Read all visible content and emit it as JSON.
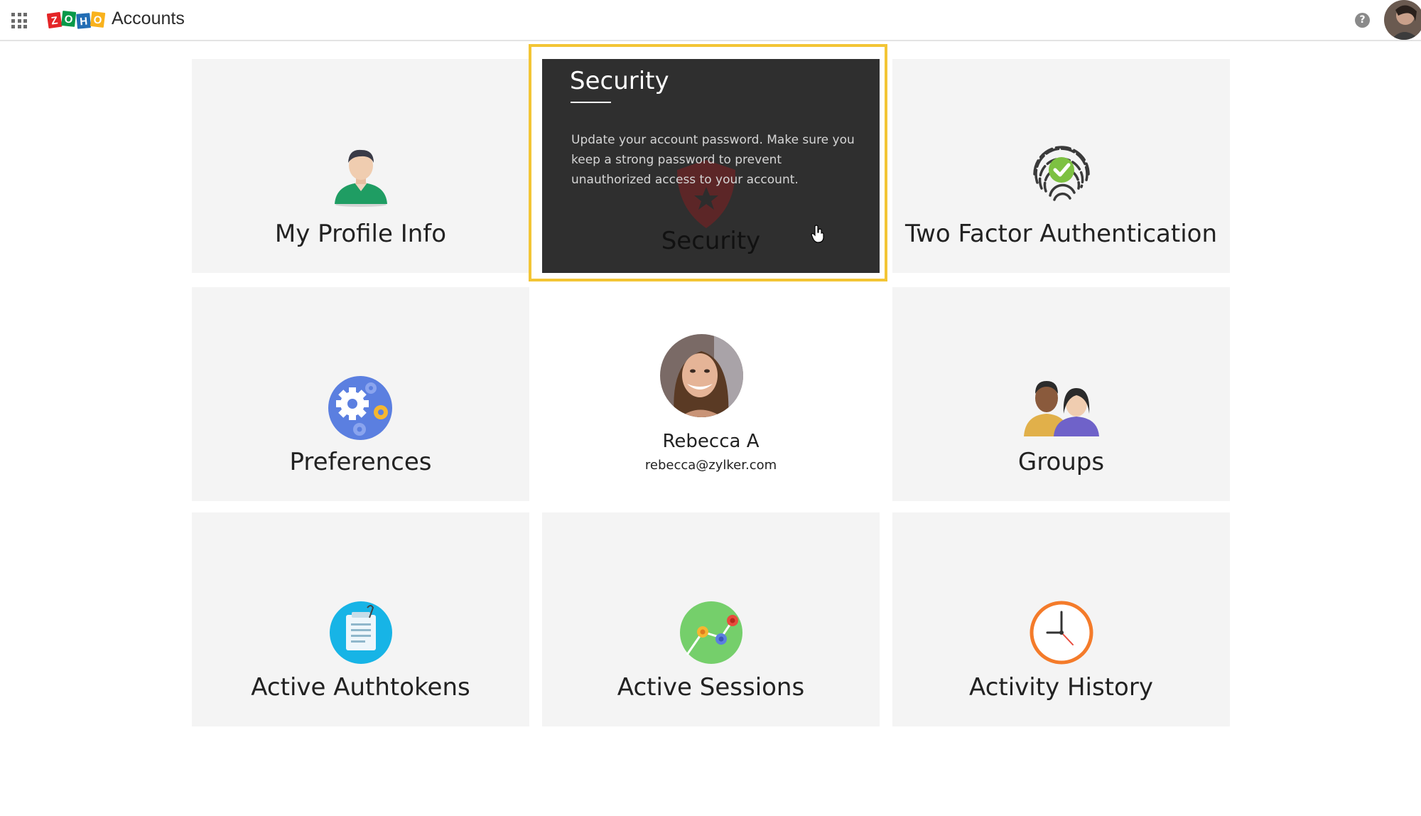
{
  "header": {
    "app_title": "Accounts",
    "logo_letters": [
      "Z",
      "O",
      "H",
      "O"
    ],
    "help_symbol": "?"
  },
  "tiles": {
    "my_profile": {
      "label": "My Profile Info",
      "icon": "person-icon"
    },
    "security": {
      "title": "Security",
      "description": "Update your account password. Make sure you keep a strong password to prevent unauthorized access to your account.",
      "label": "Security",
      "icon": "shield-icon"
    },
    "two_factor": {
      "label": "Two Factor Authentication",
      "icon": "fingerprint-icon"
    },
    "preferences": {
      "label": "Preferences",
      "icon": "gears-icon"
    },
    "groups": {
      "label": "Groups",
      "icon": "group-icon"
    },
    "authtokens": {
      "label": "Active Authtokens",
      "icon": "document-icon"
    },
    "sessions": {
      "label": "Active Sessions",
      "icon": "sessions-icon"
    },
    "history": {
      "label": "Activity History",
      "icon": "clock-icon"
    }
  },
  "profile": {
    "name": "Rebecca A",
    "email": "rebecca@zylker.com"
  },
  "colors": {
    "highlight": "#f3c535",
    "tile_bg": "#f4f4f4",
    "security_bg": "#2f2f2f",
    "logo_z": "#e42527",
    "logo_o1": "#089949",
    "logo_h": "#226db4",
    "logo_o2": "#f9b21d"
  }
}
